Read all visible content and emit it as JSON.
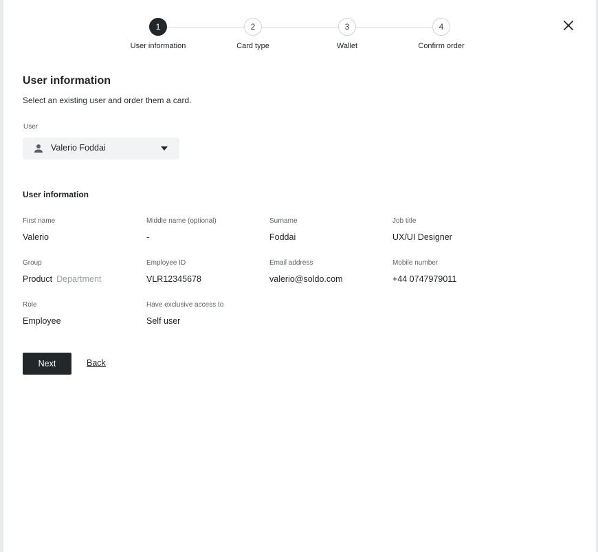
{
  "stepper": {
    "steps": [
      {
        "number": "1",
        "label": "User information",
        "active": true
      },
      {
        "number": "2",
        "label": "Card type",
        "active": false
      },
      {
        "number": "3",
        "label": "Wallet",
        "active": false
      },
      {
        "number": "4",
        "label": "Confirm order",
        "active": false
      }
    ]
  },
  "header": {
    "close_icon": "close-icon"
  },
  "form": {
    "title": "User information",
    "subtitle": "Select an existing user and order them a card.",
    "user_field": {
      "label": "User",
      "value": "Valerio Foddai",
      "icon": "person-icon"
    }
  },
  "user_info": {
    "section_title": "User information",
    "first_name": {
      "label": "First name",
      "value": "Valerio"
    },
    "middle_name": {
      "label": "Middle name (optional)",
      "value": "-"
    },
    "surname": {
      "label": "Surname",
      "value": "Foddai"
    },
    "job_title": {
      "label": "Job title",
      "value": "UX/UI Designer"
    },
    "group": {
      "label": "Group",
      "value": "Product",
      "secondary": "Department"
    },
    "employee_id": {
      "label": "Employee ID",
      "value": "VLR12345678"
    },
    "email": {
      "label": "Email address",
      "value": "valerio@soldo.com"
    },
    "mobile": {
      "label": "Mobile number",
      "value": "+44 0747979011"
    },
    "role": {
      "label": "Role",
      "value": "Employee"
    },
    "exclusive_access": {
      "label": "Have exclusive access to",
      "value": "Self user"
    }
  },
  "actions": {
    "next_label": "Next",
    "back_label": "Back"
  },
  "colors": {
    "primary": "#22272b",
    "background": "#ffffff",
    "muted": "#9aa0a6"
  }
}
